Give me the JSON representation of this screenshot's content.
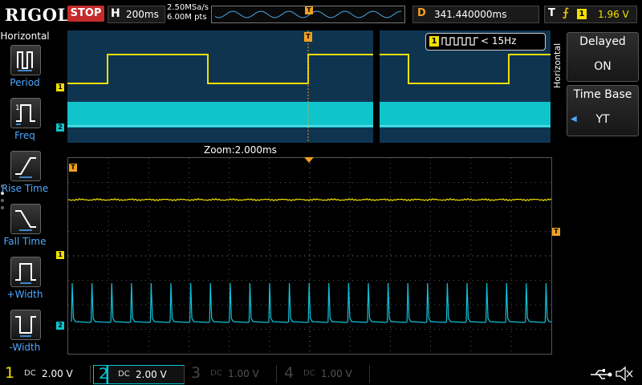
{
  "topbar": {
    "brand": "RIGOL",
    "run_state": "STOP",
    "timebase_letter": "H",
    "timebase": "200ms",
    "sample_rate": "2.50MSa/s",
    "memory_depth": "6.00M pts",
    "trigger_marker": "T",
    "delay_letter": "D",
    "delay": "341.440000ms",
    "trigger_letter": "T",
    "trigger_slope": "rising-edge-icon",
    "trigger_source": "1",
    "trigger_level": "1.96 V"
  },
  "left_menu": {
    "title": "Horizontal",
    "items": [
      {
        "label": "Period",
        "icon": "period-icon"
      },
      {
        "label": "Freq",
        "icon": "frequency-icon"
      },
      {
        "label": "Rise Time",
        "icon": "rise-time-icon"
      },
      {
        "label": "Fall Time",
        "icon": "fall-time-icon"
      },
      {
        "label": "+Width",
        "icon": "positive-width-icon"
      },
      {
        "label": "-Width",
        "icon": "negative-width-icon"
      }
    ]
  },
  "right_menu": {
    "vertical_title": "Horizontal",
    "delayed_title": "Delayed",
    "delayed_value": "ON",
    "timebase_title": "Time Base",
    "timebase_value": "YT"
  },
  "overview": {
    "freq_channel": "1",
    "freq_text": "< 15Hz",
    "ch1_marker": "1",
    "ch2_marker": "2"
  },
  "zoom": {
    "label": "Zoom:2.000ms",
    "ch1_marker": "1",
    "ch2_marker": "2",
    "trigger_marker": "T"
  },
  "channels": [
    {
      "num": "1",
      "coupling": "DC",
      "scale": "2.00 V",
      "color": "#f0e000",
      "active": true
    },
    {
      "num": "2",
      "coupling": "DC",
      "scale": "2.00 V",
      "color": "#00c8d8",
      "active": true
    },
    {
      "num": "3",
      "coupling": "DC",
      "scale": "1.00 V",
      "color": "#b050c0",
      "active": false
    },
    {
      "num": "4",
      "coupling": "DC",
      "scale": "1.00 V",
      "color": "#3a70d0",
      "active": false
    }
  ],
  "colors": {
    "ch1": "#f0e000",
    "ch2": "#00c8d8",
    "trigger": "#f0a020",
    "menu_label": "#4fa8ff",
    "stop": "#c62b2b"
  },
  "status_icons": [
    "usb-icon",
    "speaker-muted-icon"
  ]
}
